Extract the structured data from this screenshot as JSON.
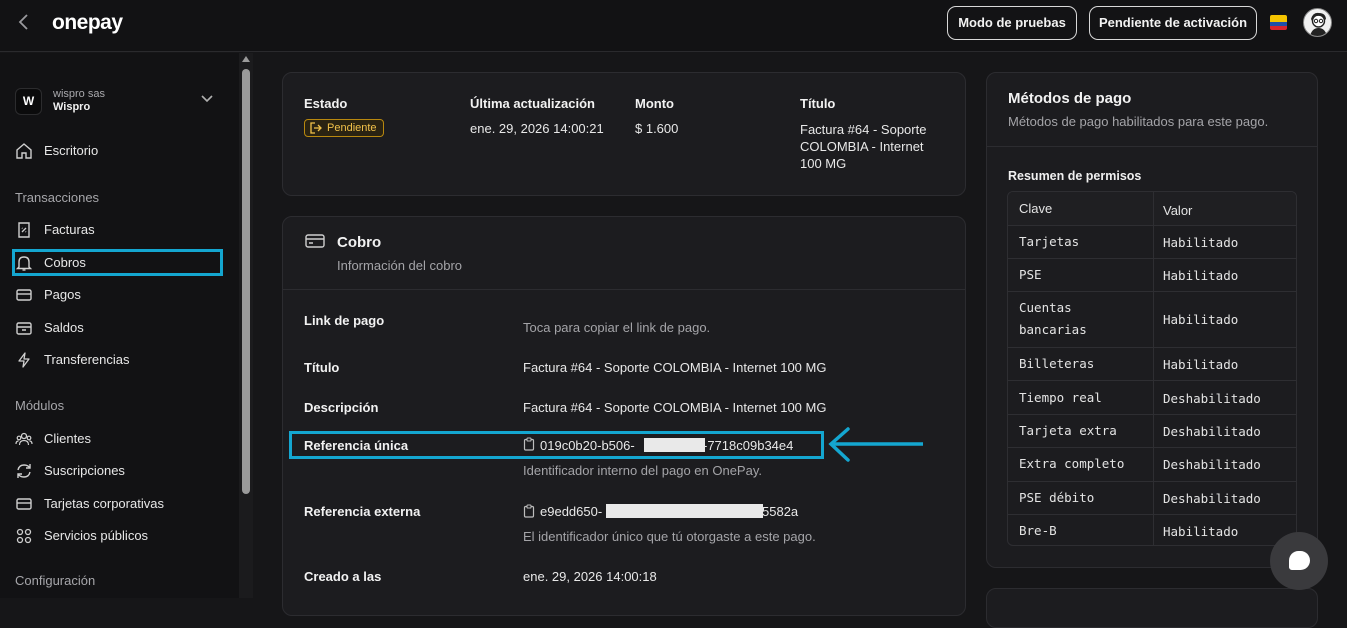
{
  "topbar": {
    "logo": "onepay",
    "test_mode_label": "Modo de pruebas",
    "activation_label": "Pendiente de activación",
    "flag_colors": [
      "#f4c400",
      "#1f4fa8",
      "#d8242c"
    ]
  },
  "sidebar": {
    "org_initial": "W",
    "org_subtitle": "wispro sas",
    "org_name": "Wispro",
    "items": {
      "escritorio": "Escritorio",
      "facturas": "Facturas",
      "cobros": "Cobros",
      "pagos": "Pagos",
      "saldos": "Saldos",
      "transferencias": "Transferencias",
      "clientes": "Clientes",
      "suscripciones": "Suscripciones",
      "tarjetas": "Tarjetas corporativas",
      "servicios": "Servicios públicos"
    },
    "sections": {
      "transacciones": "Transacciones",
      "modulos": "Módulos",
      "configuracion": "Configuración"
    }
  },
  "summary": {
    "estado_label": "Estado",
    "estado_value": "Pendiente",
    "actualizacion_label": "Última actualización",
    "actualizacion_value": "ene. 29, 2026 14:00:21",
    "monto_label": "Monto",
    "monto_value": "$ 1.600",
    "titulo_label": "Título",
    "titulo_value": "Factura #64 - Soporte COLOMBIA - Internet 100 MG"
  },
  "cobro": {
    "title": "Cobro",
    "subtitle": "Información del cobro",
    "link_label": "Link de pago",
    "link_value": "Toca para copiar el link de pago.",
    "titulo_label": "Título",
    "titulo_value": "Factura #64 - Soporte COLOMBIA - Internet 100 MG",
    "descripcion_label": "Descripción",
    "descripcion_value": "Factura #64 - Soporte COLOMBIA - Internet 100 MG",
    "ref_unica_label": "Referencia única",
    "ref_unica_prefix": "019c0b20-b506-",
    "ref_unica_suffix": "-7718c09b34e4",
    "ref_unica_help": "Identificador interno del pago en OnePay.",
    "ref_externa_label": "Referencia externa",
    "ref_externa_prefix": "e9edd650-",
    "ref_externa_suffix": "5582a",
    "ref_externa_help": "El identificador único que tú otorgaste a este pago.",
    "creado_label": "Creado a las",
    "creado_value": "ene. 29, 2026 14:00:18"
  },
  "metodos": {
    "title": "Métodos de pago",
    "subtitle": "Métodos de pago habilitados para este pago.",
    "resumen_label": "Resumen de permisos",
    "col_clave": "Clave",
    "col_valor": "Valor",
    "rows": [
      {
        "clave": "Tarjetas",
        "valor": "Habilitado"
      },
      {
        "clave": "PSE",
        "valor": "Habilitado"
      },
      {
        "clave": "Cuentas bancarias",
        "valor": "Habilitado"
      },
      {
        "clave": "Billeteras",
        "valor": "Habilitado"
      },
      {
        "clave": "Tiempo real",
        "valor": "Deshabilitado"
      },
      {
        "clave": "Tarjeta extra",
        "valor": "Deshabilitado"
      },
      {
        "clave": "Extra completo",
        "valor": "Deshabilitado"
      },
      {
        "clave": "PSE débito",
        "valor": "Deshabilitado"
      },
      {
        "clave": "Bre-B",
        "valor": "Habilitado"
      }
    ]
  },
  "annotation_color": "#14a6d0"
}
